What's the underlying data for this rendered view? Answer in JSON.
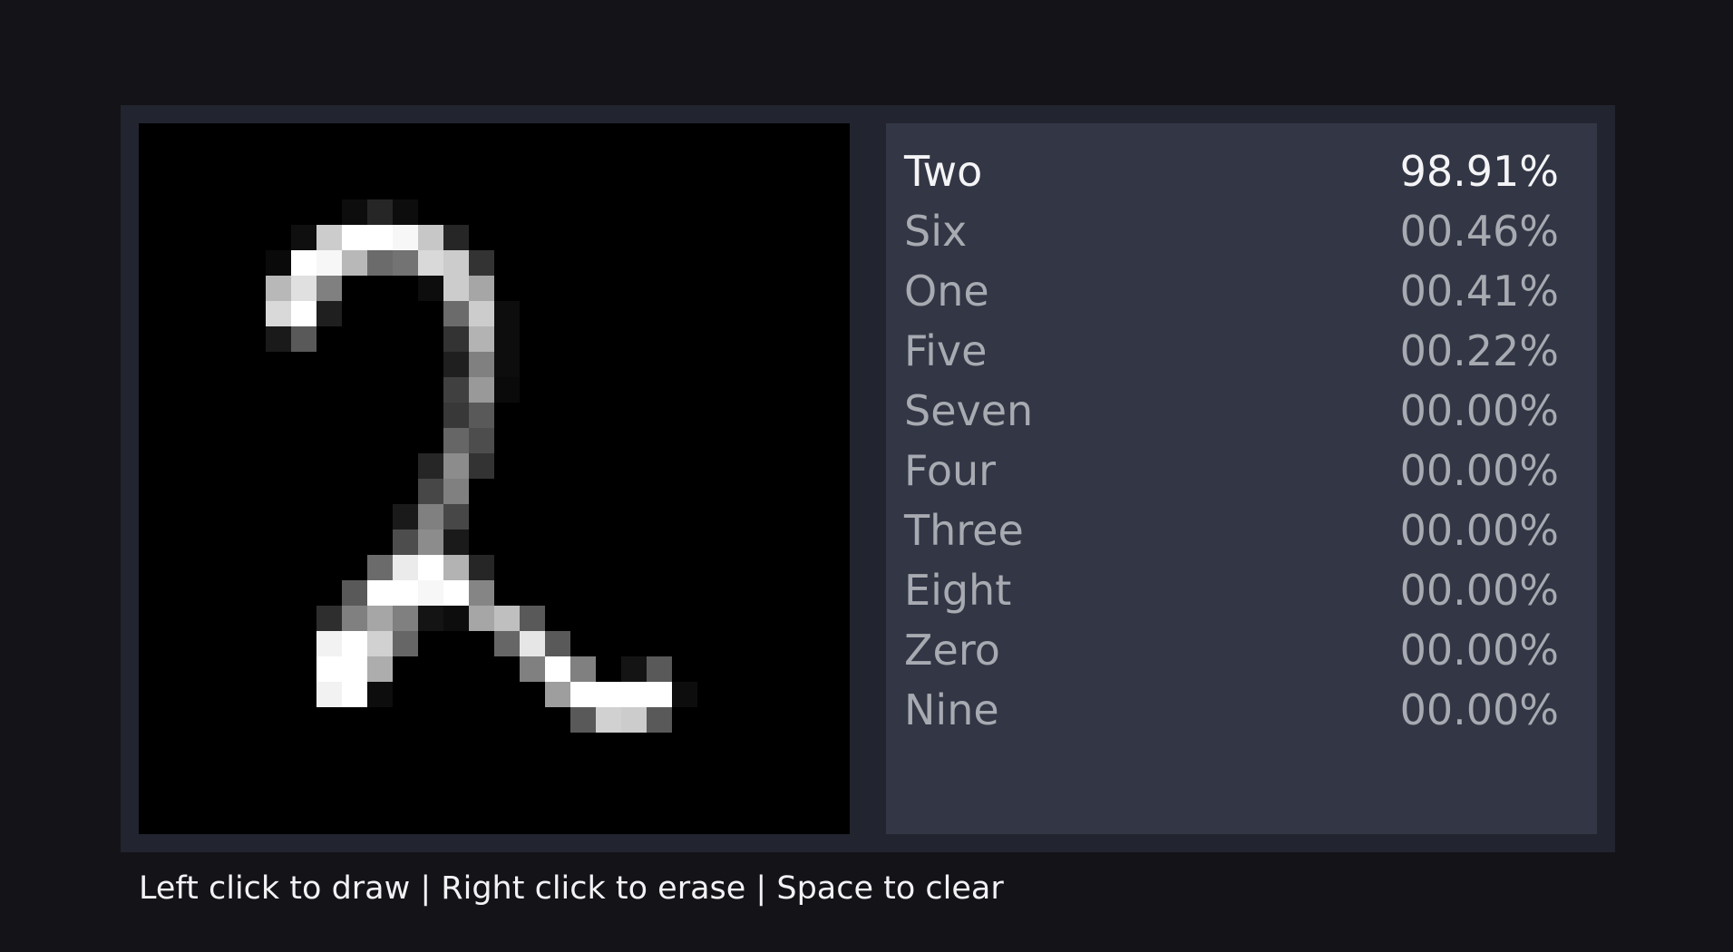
{
  "canvas": {
    "grid_size": 28,
    "pixels": [
      [
        8,
        10,
        0.05
      ],
      [
        9,
        10,
        0.15
      ],
      [
        10,
        10,
        0.05
      ],
      [
        6,
        11,
        0.06
      ],
      [
        7,
        11,
        0.8
      ],
      [
        8,
        11,
        1.0
      ],
      [
        9,
        11,
        1.0
      ],
      [
        10,
        11,
        0.97
      ],
      [
        11,
        11,
        0.78
      ],
      [
        12,
        11,
        0.15
      ],
      [
        5,
        12,
        0.04
      ],
      [
        6,
        12,
        1.0
      ],
      [
        7,
        12,
        0.97
      ],
      [
        8,
        12,
        0.72
      ],
      [
        9,
        12,
        0.42
      ],
      [
        10,
        12,
        0.45
      ],
      [
        11,
        12,
        0.85
      ],
      [
        12,
        12,
        0.8
      ],
      [
        13,
        12,
        0.2
      ],
      [
        5,
        13,
        0.72
      ],
      [
        6,
        13,
        0.88
      ],
      [
        7,
        13,
        0.5
      ],
      [
        11,
        13,
        0.05
      ],
      [
        12,
        13,
        0.8
      ],
      [
        13,
        13,
        0.65
      ],
      [
        5,
        14,
        0.85
      ],
      [
        6,
        14,
        1.0
      ],
      [
        7,
        14,
        0.12
      ],
      [
        12,
        14,
        0.42
      ],
      [
        13,
        14,
        0.8
      ],
      [
        14,
        14,
        0.05
      ],
      [
        5,
        15,
        0.1
      ],
      [
        6,
        15,
        0.35
      ],
      [
        12,
        15,
        0.2
      ],
      [
        13,
        15,
        0.7
      ],
      [
        14,
        15,
        0.05
      ],
      [
        12,
        16,
        0.12
      ],
      [
        13,
        16,
        0.5
      ],
      [
        14,
        16,
        0.05
      ],
      [
        12,
        17,
        0.25
      ],
      [
        13,
        17,
        0.6
      ],
      [
        14,
        17,
        0.04
      ],
      [
        12,
        18,
        0.22
      ],
      [
        13,
        18,
        0.35
      ],
      [
        12,
        19,
        0.4
      ],
      [
        13,
        19,
        0.3
      ],
      [
        11,
        20,
        0.15
      ],
      [
        12,
        20,
        0.55
      ],
      [
        13,
        20,
        0.2
      ],
      [
        11,
        21,
        0.28
      ],
      [
        12,
        21,
        0.5
      ],
      [
        10,
        22,
        0.1
      ],
      [
        11,
        22,
        0.5
      ],
      [
        12,
        22,
        0.28
      ],
      [
        10,
        23,
        0.3
      ],
      [
        11,
        23,
        0.55
      ],
      [
        12,
        23,
        0.1
      ],
      [
        9,
        24,
        0.42
      ],
      [
        10,
        24,
        0.92
      ],
      [
        11,
        24,
        1.0
      ],
      [
        12,
        24,
        0.7
      ],
      [
        13,
        24,
        0.15
      ],
      [
        8,
        25,
        0.35
      ],
      [
        9,
        25,
        1.0
      ],
      [
        10,
        25,
        1.0
      ],
      [
        11,
        25,
        0.97
      ],
      [
        12,
        25,
        1.0
      ],
      [
        13,
        25,
        0.52
      ],
      [
        7,
        26,
        0.18
      ],
      [
        8,
        26,
        0.5
      ],
      [
        9,
        26,
        0.65
      ],
      [
        10,
        26,
        0.5
      ],
      [
        11,
        26,
        0.08
      ],
      [
        12,
        26,
        0.05
      ],
      [
        13,
        26,
        0.65
      ],
      [
        14,
        26,
        0.75
      ],
      [
        15,
        26,
        0.35
      ],
      [
        7,
        27,
        0.95
      ],
      [
        8,
        27,
        1.0
      ],
      [
        9,
        27,
        0.82
      ],
      [
        10,
        27,
        0.4
      ],
      [
        14,
        27,
        0.4
      ],
      [
        15,
        27,
        0.9
      ],
      [
        16,
        27,
        0.35
      ]
    ],
    "pixels_lower": [
      [
        7,
        28,
        1.0
      ],
      [
        8,
        28,
        1.0
      ],
      [
        9,
        28,
        0.68
      ],
      [
        15,
        28,
        0.5
      ],
      [
        16,
        28,
        1.0
      ],
      [
        17,
        28,
        0.5
      ],
      [
        19,
        28,
        0.08
      ],
      [
        20,
        28,
        0.35
      ],
      [
        7,
        29,
        0.95
      ],
      [
        8,
        29,
        1.0
      ],
      [
        9,
        29,
        0.05
      ],
      [
        16,
        29,
        0.62
      ],
      [
        17,
        29,
        1.0
      ],
      [
        18,
        29,
        1.0
      ],
      [
        19,
        29,
        1.0
      ],
      [
        20,
        29,
        1.0
      ],
      [
        21,
        29,
        0.05
      ],
      [
        17,
        30,
        0.35
      ],
      [
        18,
        30,
        0.82
      ],
      [
        19,
        30,
        0.8
      ],
      [
        20,
        30,
        0.35
      ]
    ]
  },
  "predictions": [
    {
      "label": "Two",
      "value": "98.91%"
    },
    {
      "label": "Six",
      "value": "00.46%"
    },
    {
      "label": "One",
      "value": "00.41%"
    },
    {
      "label": "Five",
      "value": "00.22%"
    },
    {
      "label": "Seven",
      "value": "00.00%"
    },
    {
      "label": "Four",
      "value": "00.00%"
    },
    {
      "label": "Three",
      "value": "00.00%"
    },
    {
      "label": "Eight",
      "value": "00.00%"
    },
    {
      "label": "Zero",
      "value": "00.00%"
    },
    {
      "label": "Nine",
      "value": "00.00%"
    }
  ],
  "footer": {
    "instructions": "Left click to draw | Right click to erase | Space to clear"
  },
  "colors": {
    "background": "#131318",
    "frame": "#22242f",
    "results_panel": "#323645",
    "top_prediction_text": "#f4f4f6",
    "prediction_text": "#a8aab1"
  }
}
